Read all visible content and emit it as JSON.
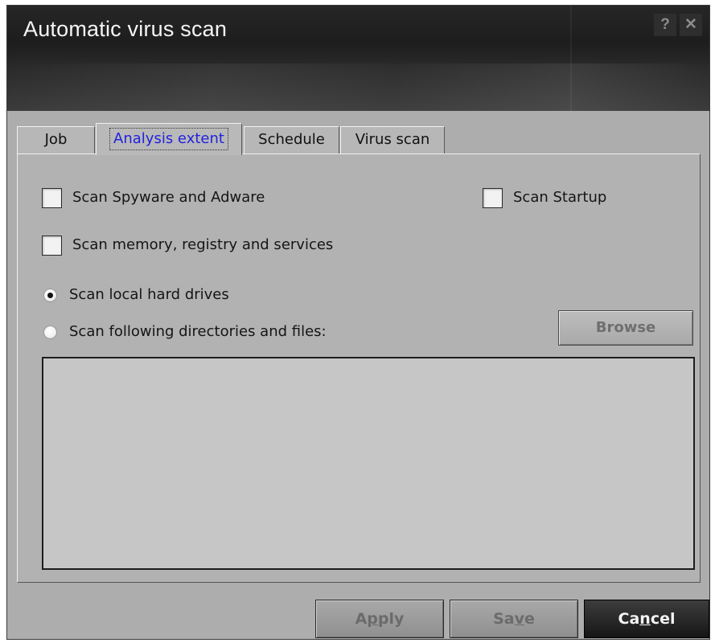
{
  "window": {
    "title": "Automatic virus scan",
    "help_label": "?",
    "close_label": "✕"
  },
  "tabs": [
    {
      "label": "Job",
      "selected": false
    },
    {
      "label": "Analysis extent",
      "selected": true
    },
    {
      "label": "Schedule",
      "selected": false
    },
    {
      "label": "Virus scan",
      "selected": false
    }
  ],
  "options": {
    "scan_spyware": {
      "label": "Scan Spyware and Adware",
      "checked": false
    },
    "scan_startup": {
      "label": "Scan Startup",
      "checked": false
    },
    "scan_memory": {
      "label": "Scan memory, registry and services",
      "checked": false
    },
    "scan_local": {
      "label": "Scan local hard drives",
      "selected": true
    },
    "scan_following": {
      "label": "Scan following directories and files:",
      "selected": false
    }
  },
  "browse_label": "Browse",
  "footer": {
    "apply_pre": "A",
    "apply_u": "p",
    "apply_post": "ply",
    "save_pre": "Sa",
    "save_u": "v",
    "save_post": "e",
    "cancel_pre": "Ca",
    "cancel_u": "n",
    "cancel_post": "cel"
  },
  "colors": {
    "accent_tab_text": "#2222dd",
    "titlebar": "#1d1d1d",
    "panel": "#b2b2b2",
    "cancel_button": "#161616"
  }
}
